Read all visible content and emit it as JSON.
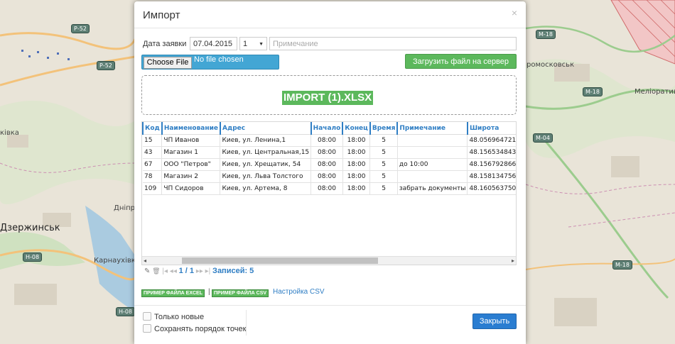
{
  "map": {
    "labels": [
      "ківка",
      "Дніпро",
      "Карнаухівка",
      "ромосковськ",
      "Меліоративне"
    ],
    "city": "Дзержинськ",
    "shields": [
      "Р-52",
      "Р-52",
      "М-18",
      "М-18",
      "М-04",
      "М-18",
      "Н-08",
      "Н-08"
    ]
  },
  "modal": {
    "title": "Импорт",
    "close_icon": "×"
  },
  "form": {
    "date_label": "Дата заявки",
    "date_value": "07.04.2015",
    "number_value": "1",
    "dropdown_arrow": "▼",
    "note_placeholder": "Примечание",
    "choose_file_label": "Choose File",
    "no_file_text": "No file chosen",
    "upload_label": "Загрузить файл на сервер",
    "file_badge": "IMPORT (1).XLSX"
  },
  "table": {
    "columns": [
      "Код",
      "Наименование",
      "Адрес",
      "Начало",
      "Конец",
      "Время",
      "Примечание",
      "Широта"
    ],
    "rows": [
      [
        "15",
        "ЧП Иванов",
        "Киев, ул. Ленина,1",
        "08:00",
        "18:00",
        "5",
        "",
        "48.056964721"
      ],
      [
        "43",
        "Магазин 1",
        "Киев, ул. Центральная,15",
        "08:00",
        "18:00",
        "5",
        "",
        "48.156534843"
      ],
      [
        "67",
        "ООО \"Петров\"",
        "Киев, ул. Хрещатик, 54",
        "08:00",
        "18:00",
        "5",
        "до 10:00",
        "48.156792866"
      ],
      [
        "78",
        "Магазин 2",
        "Киев, ул. Льва Толстого",
        "08:00",
        "18:00",
        "5",
        "",
        "48.158134756"
      ],
      [
        "109",
        "ЧП Сидоров",
        "Киев, ул. Артема, 8",
        "08:00",
        "18:00",
        "5",
        "забрать документы",
        "48.160563750"
      ]
    ]
  },
  "pager": {
    "edit_icon": "✎",
    "delete_icon": "🗑",
    "first": "|◂",
    "prev": "◂◂",
    "page": "1 / 1",
    "next": "▸▸",
    "last": "▸|",
    "records": "Записей: 5",
    "scroll_left": "◂",
    "scroll_right": "▸"
  },
  "examples": {
    "excel": "ПРИМЕР ФАЙЛА EXCEL",
    "separator": "|",
    "csv": "ПРИМЕР ФАЙЛА CSV",
    "csv_settings": "Настройка CSV"
  },
  "footer": {
    "only_new": "Только новые",
    "keep_order": "Сохранять порядок точек",
    "close_button": "Закрыть"
  }
}
